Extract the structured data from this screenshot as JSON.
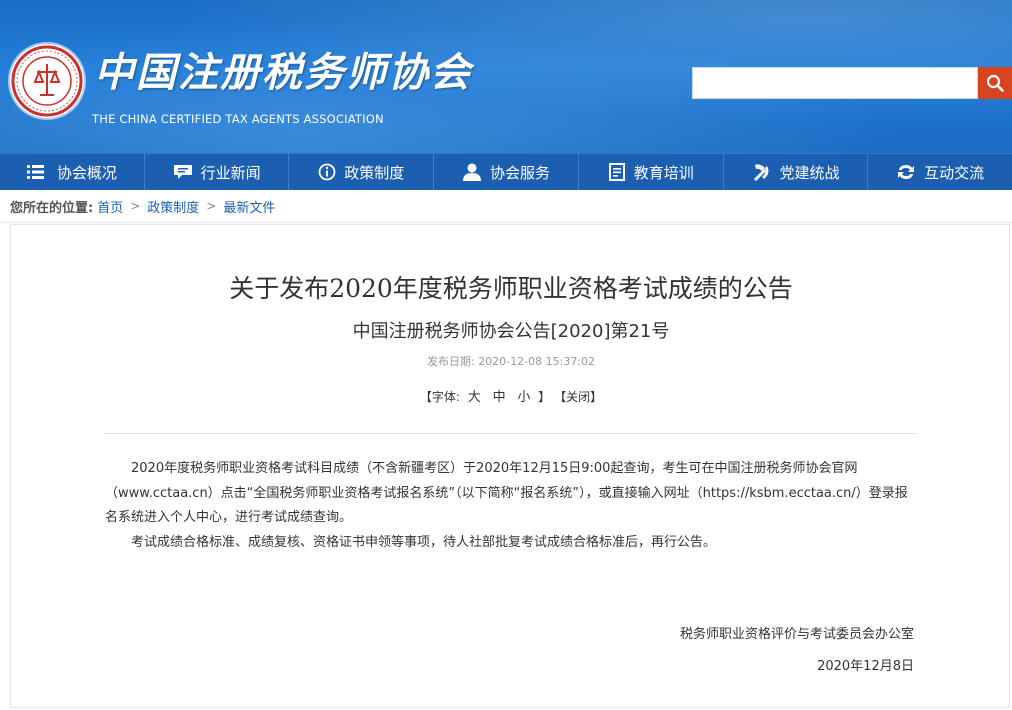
{
  "header": {
    "brand_cn": "中国注册税务师协会",
    "brand_en": "THE CHINA CERTIFIED TAX AGENTS ASSOCIATION",
    "search_placeholder": ""
  },
  "nav": {
    "items": [
      {
        "label": "协会概况",
        "icon": "menu-icon"
      },
      {
        "label": "行业新闻",
        "icon": "chat-bubble-icon"
      },
      {
        "label": "政策制度",
        "icon": "info-icon"
      },
      {
        "label": "协会服务",
        "icon": "person-icon"
      },
      {
        "label": "教育培训",
        "icon": "book-icon"
      },
      {
        "label": "党建统战",
        "icon": "party-emblem-icon"
      },
      {
        "label": "互动交流",
        "icon": "exchange-arrows-icon"
      }
    ]
  },
  "breadcrumb": {
    "label": "您所在的位置:",
    "items": [
      "首页",
      "政策制度",
      "最新文件"
    ]
  },
  "article": {
    "title": "关于发布2020年度税务师职业资格考试成绩的公告",
    "subtitle": "中国注册税务师协会公告[2020]第21号",
    "publish_label": "发布日期:",
    "publish_date": "2020-12-08 15:37:02",
    "font_label": "【字体:",
    "font_large": "大",
    "font_medium": "中",
    "font_small": "小",
    "font_end": "】",
    "close_label": "【关闭】",
    "paragraph1": "2020年度税务师职业资格考试科目成绩（不含新疆考区）于2020年12月15日9:00起查询，考生可在中国注册税务师协会官网（www.cctaa.cn）点击“全国税务师职业资格考试报名系统”（以下简称“报名系统”），或直接输入网址（https://ksbm.ecctaa.cn/）登录报名系统进入个人中心，进行考试成绩查询。",
    "paragraph2": "考试成绩合格标准、成绩复核、资格证书申领等事项，待人社部批复考试成绩合格标准后，再行公告。",
    "signature": "税务师职业资格评价与考试委员会办公室",
    "date": "2020年12月8日"
  },
  "colors": {
    "header_blue": "#1e7ad6",
    "nav_blue": "#1c5fb0",
    "search_button": "#d8441f",
    "link": "#1d5fb0"
  }
}
